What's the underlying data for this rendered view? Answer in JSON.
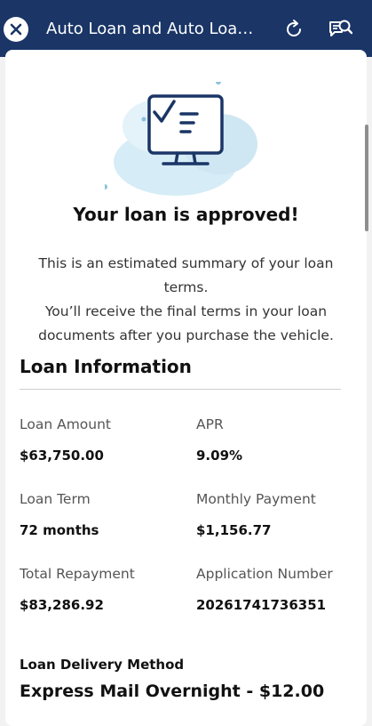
{
  "header": {
    "title": "Auto Loan and Auto Loan...",
    "close_icon": "close-icon",
    "refresh_icon": "refresh-icon",
    "chat_icon": "chat-search-icon"
  },
  "approval": {
    "heading": "Your loan is approved!",
    "summary_lines": [
      "This is an estimated summary of your loan terms.",
      "You’ll receive the final terms in your loan",
      "documents after you purchase the vehicle."
    ]
  },
  "loan_info": {
    "title": "Loan Information",
    "fields": [
      {
        "label": "Loan Amount",
        "value": "$63,750.00"
      },
      {
        "label": "APR",
        "value": "9.09%"
      },
      {
        "label": "Loan Term",
        "value": "72 months"
      },
      {
        "label": "Monthly Payment",
        "value": "$1,156.77"
      },
      {
        "label": "Total Repayment",
        "value": "$83,286.92"
      },
      {
        "label": "Application Number",
        "value": "20261741736351"
      }
    ]
  },
  "delivery": {
    "label": "Loan Delivery Method",
    "value": "Express Mail Overnight - $12.00"
  },
  "colors": {
    "header_bg": "#1a3566",
    "illustration_stroke": "#1a3566",
    "illustration_bubble": "#d6ecf6"
  }
}
